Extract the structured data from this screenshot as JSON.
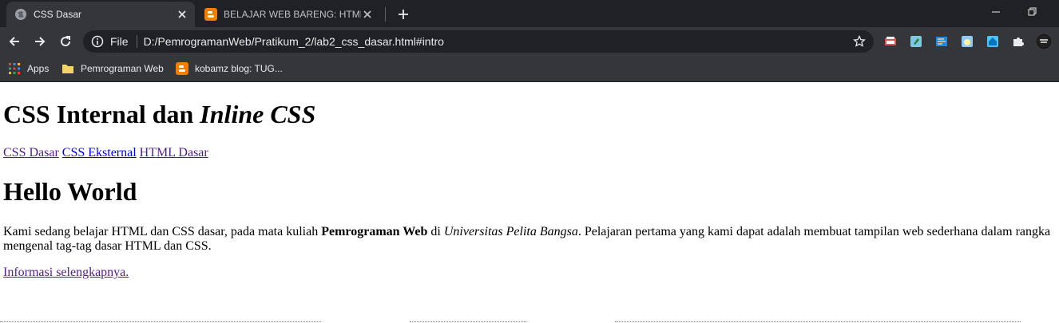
{
  "browser": {
    "tabs": [
      {
        "title": "CSS Dasar",
        "icon": "globe-icon",
        "active": true
      },
      {
        "title": "BELAJAR WEB BARENG: HTML DASAR",
        "icon": "blogger-icon",
        "active": false
      }
    ],
    "address": {
      "scheme_label": "File",
      "url": "D:/PemrogramanWeb/Pratikum_2/lab2_css_dasar.html#intro"
    },
    "bookmarks": [
      {
        "label": "Apps",
        "icon": "apps-grid-icon"
      },
      {
        "label": "Pemrograman Web",
        "icon": "folder-icon"
      },
      {
        "label": "kobamz blog: TUG...",
        "icon": "blogger-icon"
      }
    ],
    "colors": {
      "titlebar": "#202124",
      "toolbar": "#35363a",
      "omnibox": "#202124",
      "blogger_orange": "#f57d00"
    }
  },
  "page": {
    "heading": {
      "plain": "CSS Internal dan ",
      "italic": "Inline CSS"
    },
    "nav_links": [
      {
        "label": "CSS Dasar",
        "state": "visited"
      },
      {
        "label": "CSS Eksternal",
        "state": "unvisited"
      },
      {
        "label": "HTML Dasar",
        "state": "visited"
      }
    ],
    "subheading": "Hello World",
    "paragraph": {
      "part1": "Kami sedang belajar HTML dan CSS dasar, pada mata kuliah ",
      "bold": "Pemrograman Web",
      "part2": " di ",
      "italic": "Universitas Pelita Bangsa",
      "part3": ". Pelajaran pertama yang kami dapat adalah membuat tampilan web sederhana dalam rangka mengenal tag-tag dasar HTML dan CSS."
    },
    "more_link": "Informasi selengkapnya."
  }
}
